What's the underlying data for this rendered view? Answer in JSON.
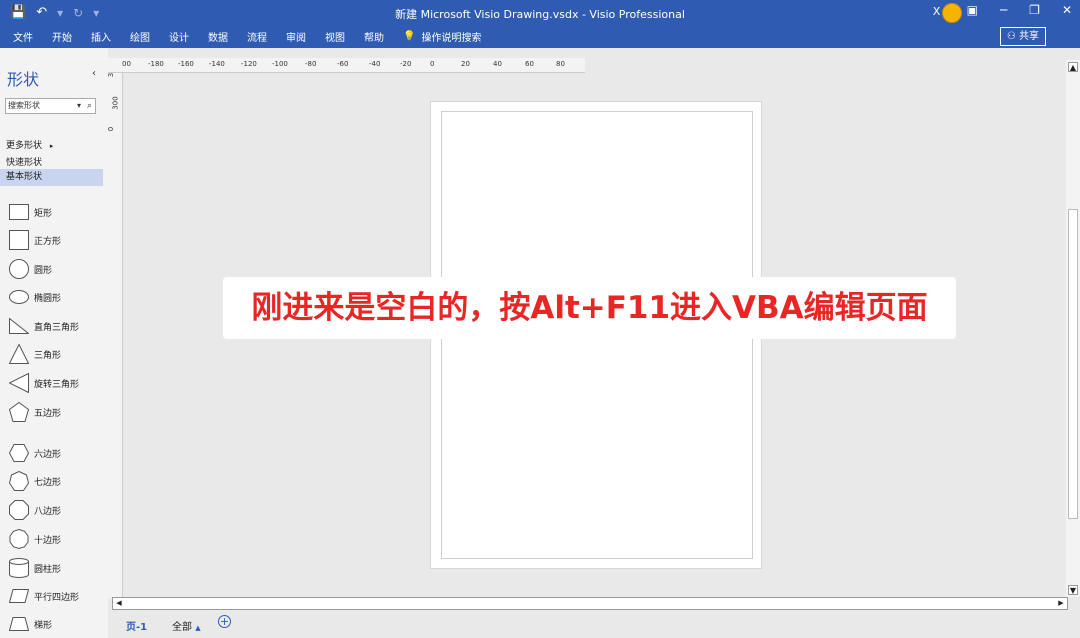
{
  "app": {
    "title": "新建 Microsoft Visio Drawing.vsdx  -  Visio Professional",
    "user_initials": "X H"
  },
  "quick_access": {
    "save_icon": "save-icon",
    "undo_icon": "undo-icon",
    "redo_icon": "redo-icon",
    "customize_icon": "customize-qat-icon"
  },
  "menu": {
    "items": [
      "文件",
      "开始",
      "插入",
      "绘图",
      "设计",
      "数据",
      "流程",
      "审阅",
      "视图",
      "帮助"
    ],
    "tell_me": "操作说明搜索",
    "share": "共享"
  },
  "shapes_pane": {
    "title": "形状",
    "search_placeholder": "搜索形状",
    "more_shapes": "更多形状",
    "quick_shapes": "快速形状",
    "basic_shapes": "基本形状",
    "items": [
      {
        "label": "矩形",
        "icon": "rectangle-icon"
      },
      {
        "label": "正方形",
        "icon": "square-icon"
      },
      {
        "label": "圆形",
        "icon": "circle-icon"
      },
      {
        "label": "椭圆形",
        "icon": "ellipse-icon"
      },
      {
        "label": "直角三角形",
        "icon": "right-triangle-icon"
      },
      {
        "label": "三角形",
        "icon": "triangle-icon"
      },
      {
        "label": "旋转三角形",
        "icon": "rotated-triangle-icon"
      },
      {
        "label": "五边形",
        "icon": "pentagon-icon"
      },
      {
        "label": "六边形",
        "icon": "hexagon-icon"
      },
      {
        "label": "七边形",
        "icon": "heptagon-icon"
      },
      {
        "label": "八边形",
        "icon": "octagon-icon"
      },
      {
        "label": "十边形",
        "icon": "decagon-icon"
      },
      {
        "label": "圆柱形",
        "icon": "cylinder-icon"
      },
      {
        "label": "平行四边形",
        "icon": "parallelogram-icon"
      },
      {
        "label": "梯形",
        "icon": "trapezoid-icon"
      }
    ]
  },
  "ruler": {
    "horizontal": [
      "00",
      "-180",
      "-160",
      "-140",
      "-120",
      "-100",
      "-80",
      "-60",
      "-40",
      "-20",
      "0",
      "20",
      "40",
      "60",
      "80"
    ],
    "vertical": [
      "3",
      "300",
      "0"
    ]
  },
  "overlay": {
    "text": "刚进来是空白的，按Alt+F11进入VBA编辑页面"
  },
  "page_tabs": {
    "page": "页-1",
    "all": "全部",
    "add_icon": "add-page-icon"
  }
}
